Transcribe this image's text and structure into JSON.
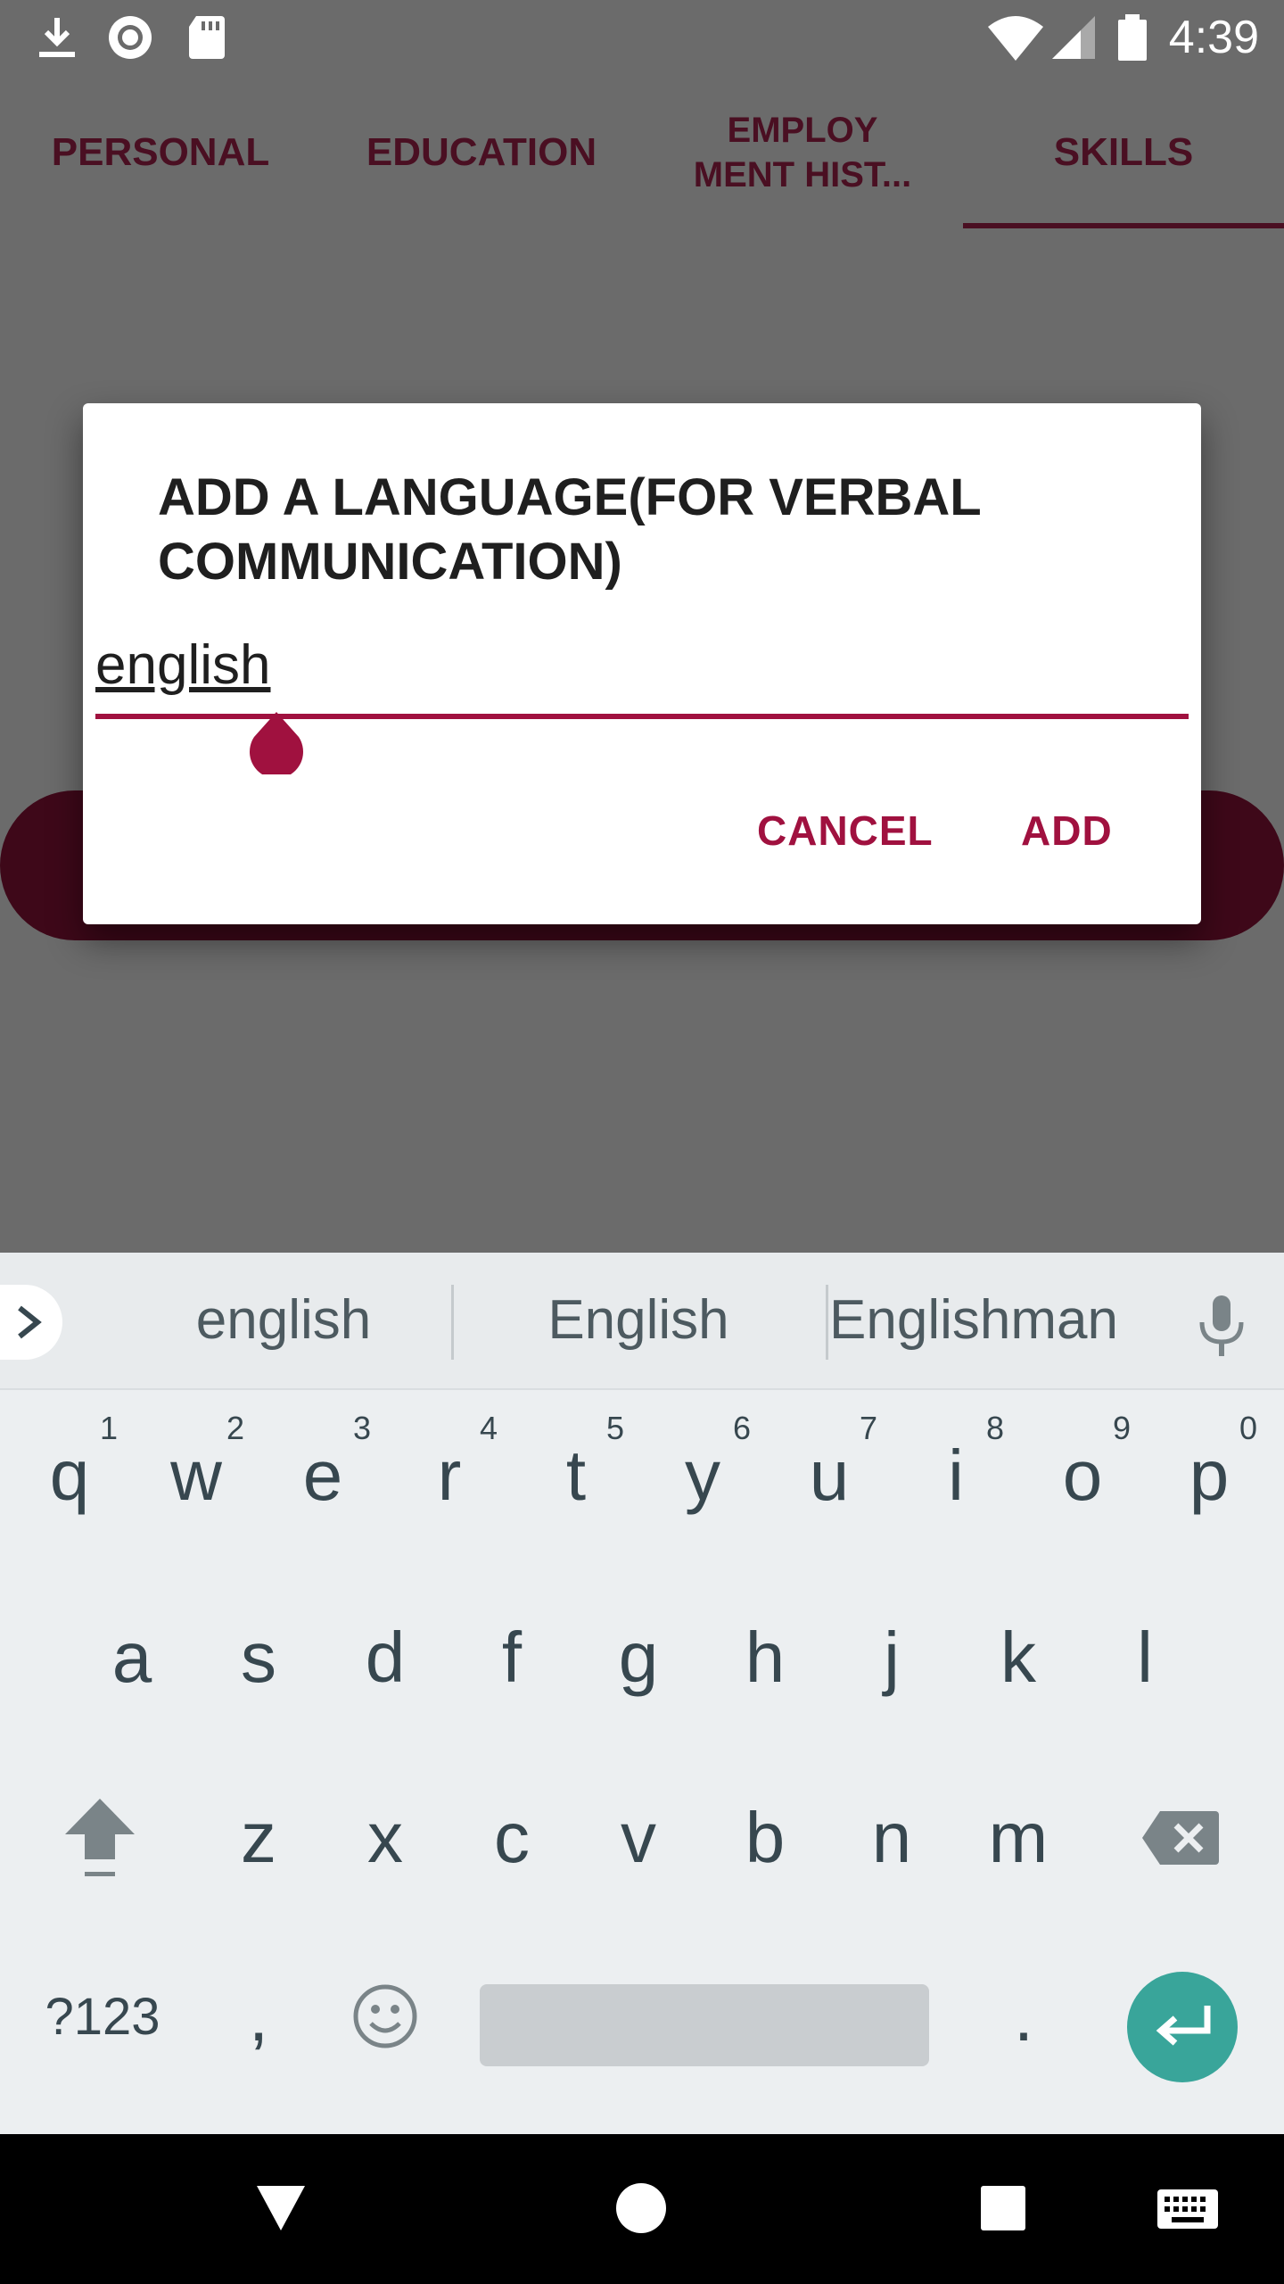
{
  "status_bar": {
    "time": "4:39",
    "icons": [
      "download-icon",
      "record-icon",
      "sd-card-icon",
      "wifi-icon",
      "signal-icon",
      "battery-icon"
    ]
  },
  "tabs": [
    {
      "label": "PERSONAL"
    },
    {
      "label_line1": "EDUCATION"
    },
    {
      "label_line1": "EMPLOY",
      "label_line2": "MENT HIST..."
    },
    {
      "label": "SKILLS",
      "selected": true
    }
  ],
  "dialog": {
    "title": "ADD A LANGUAGE(FOR VERBAL COMMUNICATION)",
    "input_value": "english",
    "cancel_label": "CANCEL",
    "add_label": "ADD"
  },
  "keyboard": {
    "suggestions": [
      "english",
      "English",
      "Englishman"
    ],
    "row1": [
      {
        "key": "q",
        "hint": "1"
      },
      {
        "key": "w",
        "hint": "2"
      },
      {
        "key": "e",
        "hint": "3"
      },
      {
        "key": "r",
        "hint": "4"
      },
      {
        "key": "t",
        "hint": "5"
      },
      {
        "key": "y",
        "hint": "6"
      },
      {
        "key": "u",
        "hint": "7"
      },
      {
        "key": "i",
        "hint": "8"
      },
      {
        "key": "o",
        "hint": "9"
      },
      {
        "key": "p",
        "hint": "0"
      }
    ],
    "row2": [
      "a",
      "s",
      "d",
      "f",
      "g",
      "h",
      "j",
      "k",
      "l"
    ],
    "row3": [
      "z",
      "x",
      "c",
      "v",
      "b",
      "n",
      "m"
    ],
    "symbols_label": "?123",
    "comma_label": ",",
    "period_label": "."
  },
  "colors": {
    "accent": "#a0113f",
    "tab_text": "#4a0f22",
    "scrim": "#6b6b6b",
    "enter_key": "#39a59a"
  }
}
